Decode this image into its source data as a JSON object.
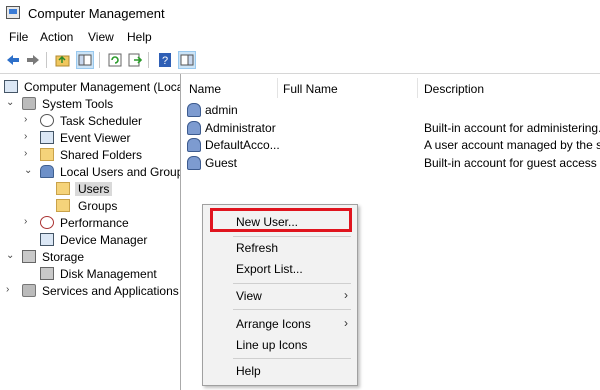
{
  "window": {
    "title": "Computer Management"
  },
  "menubar": [
    "File",
    "Action",
    "View",
    "Help"
  ],
  "toolbar": [
    {
      "icon": "back-arrow-icon"
    },
    {
      "icon": "forward-arrow-icon"
    },
    {
      "icon": "up-folder-icon"
    },
    {
      "icon": "show-hide-tree-icon"
    },
    {
      "icon": "refresh-icon"
    },
    {
      "icon": "export-list-icon"
    },
    {
      "icon": "help-icon"
    },
    {
      "icon": "properties-icon"
    }
  ],
  "tree": [
    {
      "label": "Computer Management (Local",
      "arrow": "",
      "icon": "computer-icon"
    },
    {
      "label": "System Tools",
      "arrow": "v",
      "icon": "tools-icon"
    },
    {
      "label": "Task Scheduler",
      "arrow": ">",
      "icon": "clock-icon"
    },
    {
      "label": "Event Viewer",
      "arrow": ">",
      "icon": "event-viewer-icon"
    },
    {
      "label": "Shared Folders",
      "arrow": ">",
      "icon": "shared-folder-icon"
    },
    {
      "label": "Local Users and Groups",
      "arrow": "v",
      "icon": "users-icon"
    },
    {
      "label": "Users",
      "arrow": "",
      "icon": "folder-icon"
    },
    {
      "label": "Groups",
      "arrow": "",
      "icon": "folder-icon"
    },
    {
      "label": "Performance",
      "arrow": ">",
      "icon": "performance-icon"
    },
    {
      "label": "Device Manager",
      "arrow": "",
      "icon": "device-manager-icon"
    },
    {
      "label": "Storage",
      "arrow": "v",
      "icon": "storage-icon"
    },
    {
      "label": "Disk Management",
      "arrow": "",
      "icon": "disk-icon"
    },
    {
      "label": "Services and Applications",
      "arrow": ">",
      "icon": "services-icon"
    }
  ],
  "list": {
    "columns": [
      "Name",
      "Full Name",
      "Description"
    ],
    "rows": [
      {
        "name": "admin",
        "full_name": "",
        "description": ""
      },
      {
        "name": "Administrator",
        "full_name": "",
        "description": "Built-in account for administering..."
      },
      {
        "name": "DefaultAcco...",
        "full_name": "",
        "description": "A user account managed by the s..."
      },
      {
        "name": "Guest",
        "full_name": "",
        "description": "Built-in account for guest access t..."
      }
    ]
  },
  "context_menu": {
    "items": [
      "New User...",
      "Refresh",
      "Export List...",
      "View",
      "Arrange Icons",
      "Line up Icons",
      "Help"
    ]
  },
  "colors": {
    "highlight_box": "#e0141e",
    "selection": "#cce4f7"
  }
}
